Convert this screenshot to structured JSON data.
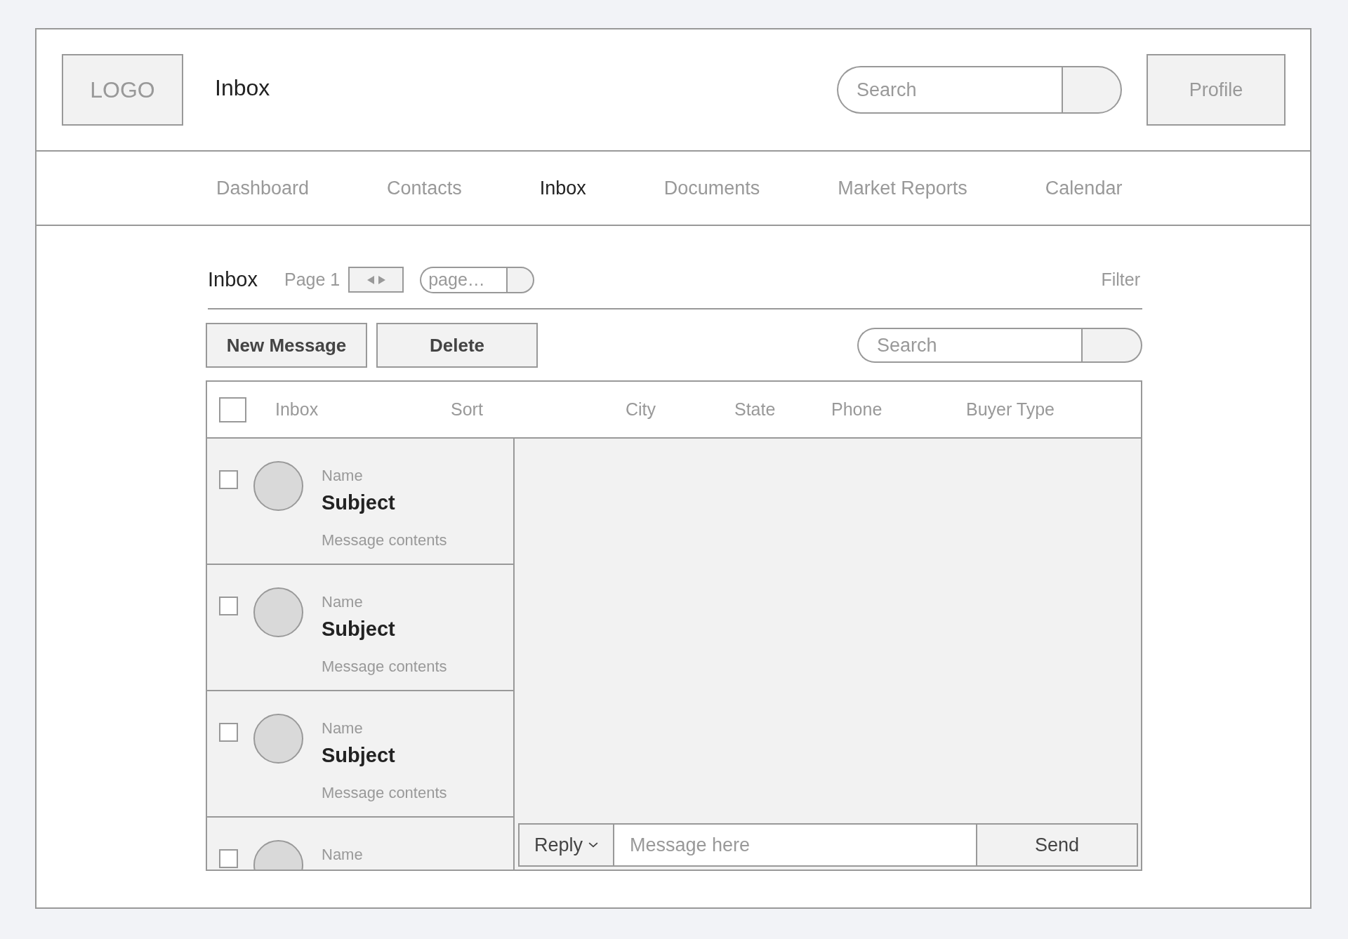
{
  "header": {
    "logo": "LOGO",
    "title": "Inbox",
    "search": {
      "placeholder": "Search"
    },
    "profile_button": "Profile"
  },
  "nav": [
    {
      "label": "Dashboard",
      "selected": false
    },
    {
      "label": "Contacts",
      "selected": false
    },
    {
      "label": "Inbox",
      "selected": true
    },
    {
      "label": "Documents",
      "selected": false
    },
    {
      "label": "Market Reports",
      "selected": false
    },
    {
      "label": "Calendar",
      "selected": false
    }
  ],
  "toolbar": {
    "title": "Inbox",
    "page_label": "Page 1",
    "page_field": {
      "placeholder": "page…"
    },
    "filter": "Filter"
  },
  "actions": [
    "New Message",
    "Delete"
  ],
  "search": {
    "placeholder": "Search"
  },
  "table": {
    "select_all": {
      "checked": false
    },
    "columns": [
      "Inbox",
      "Sort",
      "City",
      "State",
      "Phone",
      "Buyer Type"
    ],
    "messages": [
      {
        "name": "Name",
        "subject": "Subject",
        "preview": "Message contents",
        "checked": false
      },
      {
        "name": "Name",
        "subject": "Subject",
        "preview": "Message contents",
        "checked": false
      },
      {
        "name": "Name",
        "subject": "Subject",
        "preview": "Message contents",
        "checked": false
      },
      {
        "name": "Name",
        "checked": false
      }
    ]
  },
  "reply_bar": {
    "reply_button": "Reply",
    "message_field": {
      "placeholder": "Message here"
    },
    "send_button": "Send"
  }
}
